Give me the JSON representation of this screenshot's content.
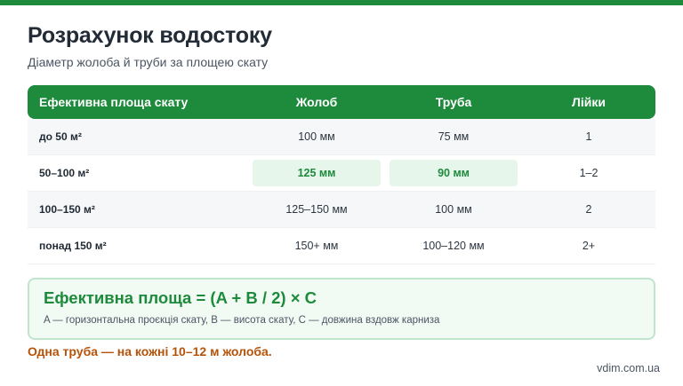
{
  "colors": {
    "accent_green": "#1e8a3c",
    "highlight_bg": "#e6f6ea",
    "note_orange": "#b45309"
  },
  "title": "Розрахунок водостоку",
  "subtitle": "Діаметр жолоба й труби за площею скату",
  "table": {
    "headers": [
      "Ефективна площа скату",
      "Жолоб",
      "Труба",
      "Лійки"
    ],
    "rows": [
      [
        "до 50 м²",
        "100 мм",
        "75 мм",
        "1"
      ],
      [
        "50–100 м²",
        "125 мм",
        "90 мм",
        "1–2"
      ],
      [
        "100–150 м²",
        "125–150 мм",
        "100 мм",
        "2"
      ],
      [
        "понад 150 м²",
        "150+ мм",
        "100–120 мм",
        "2+"
      ]
    ]
  },
  "formula": {
    "title": "Ефективна площа = (A + B / 2) × C",
    "description": "A — горизонтальна проєкція скату, B — висота скату, C — довжина вздовж карниза"
  },
  "note": "Одна труба — на кожні 10–12 м жолоба.",
  "footer": "vdim.com.ua"
}
